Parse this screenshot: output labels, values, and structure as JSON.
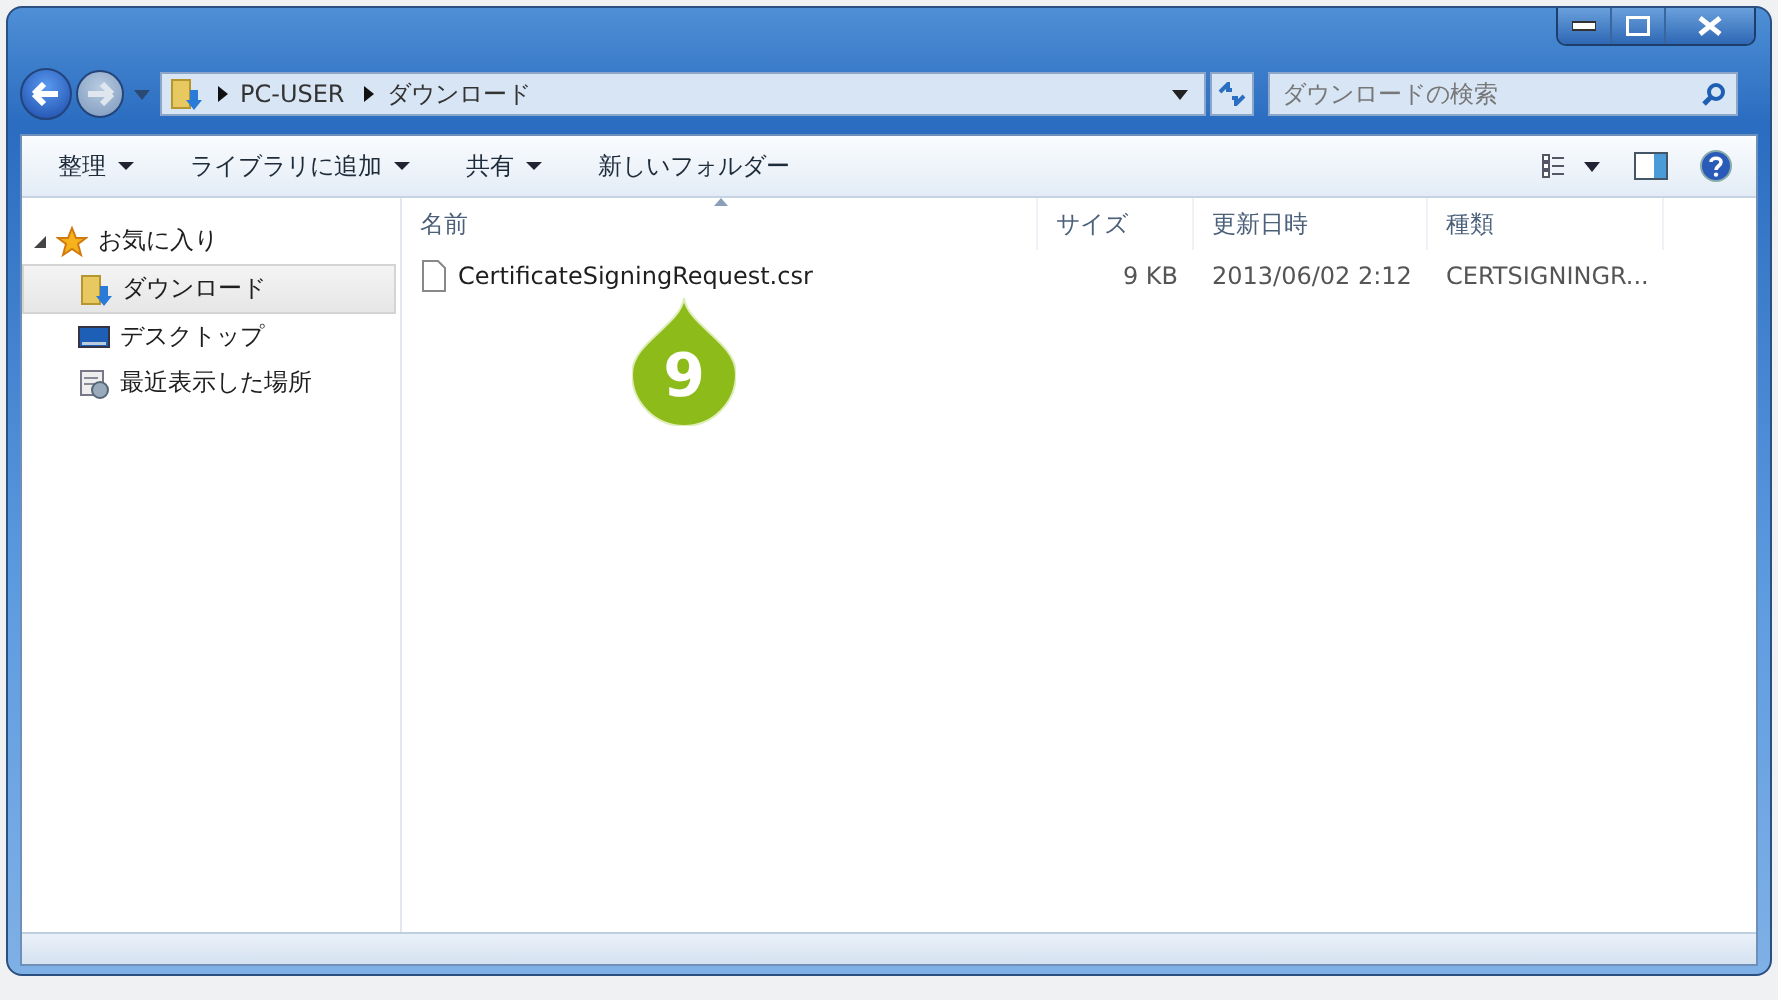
{
  "address_bar": {
    "path": [
      "PC-USER",
      "ダウンロード"
    ]
  },
  "search": {
    "placeholder": "ダウンロードの検索"
  },
  "toolbar": {
    "items": [
      {
        "label": "整理",
        "dropdown": true
      },
      {
        "label": "ライブラリに追加",
        "dropdown": true
      },
      {
        "label": "共有",
        "dropdown": true
      },
      {
        "label": "新しいフォルダー",
        "dropdown": false
      }
    ]
  },
  "sidebar": {
    "items": [
      {
        "label": "お気に入り",
        "kind": "star",
        "expanded": true,
        "selected": false,
        "children": [
          {
            "label": "ダウンロード",
            "kind": "downloads",
            "selected": true
          },
          {
            "label": "デスクトップ",
            "kind": "desktop",
            "selected": false
          },
          {
            "label": "最近表示した場所",
            "kind": "recent",
            "selected": false
          }
        ]
      }
    ]
  },
  "table": {
    "columns": [
      {
        "label": "名前",
        "sorted": true
      },
      {
        "label": "サイズ",
        "sorted": false
      },
      {
        "label": "更新日時",
        "sorted": false
      },
      {
        "label": "種類",
        "sorted": false
      }
    ],
    "rows": [
      {
        "cells": [
          "CertificateSigningRequest.csr",
          "9 KB",
          "2013/06/02 2:12",
          "CERTSIGNINGR..."
        ],
        "selected": false
      }
    ]
  },
  "callout": {
    "label": "9"
  }
}
